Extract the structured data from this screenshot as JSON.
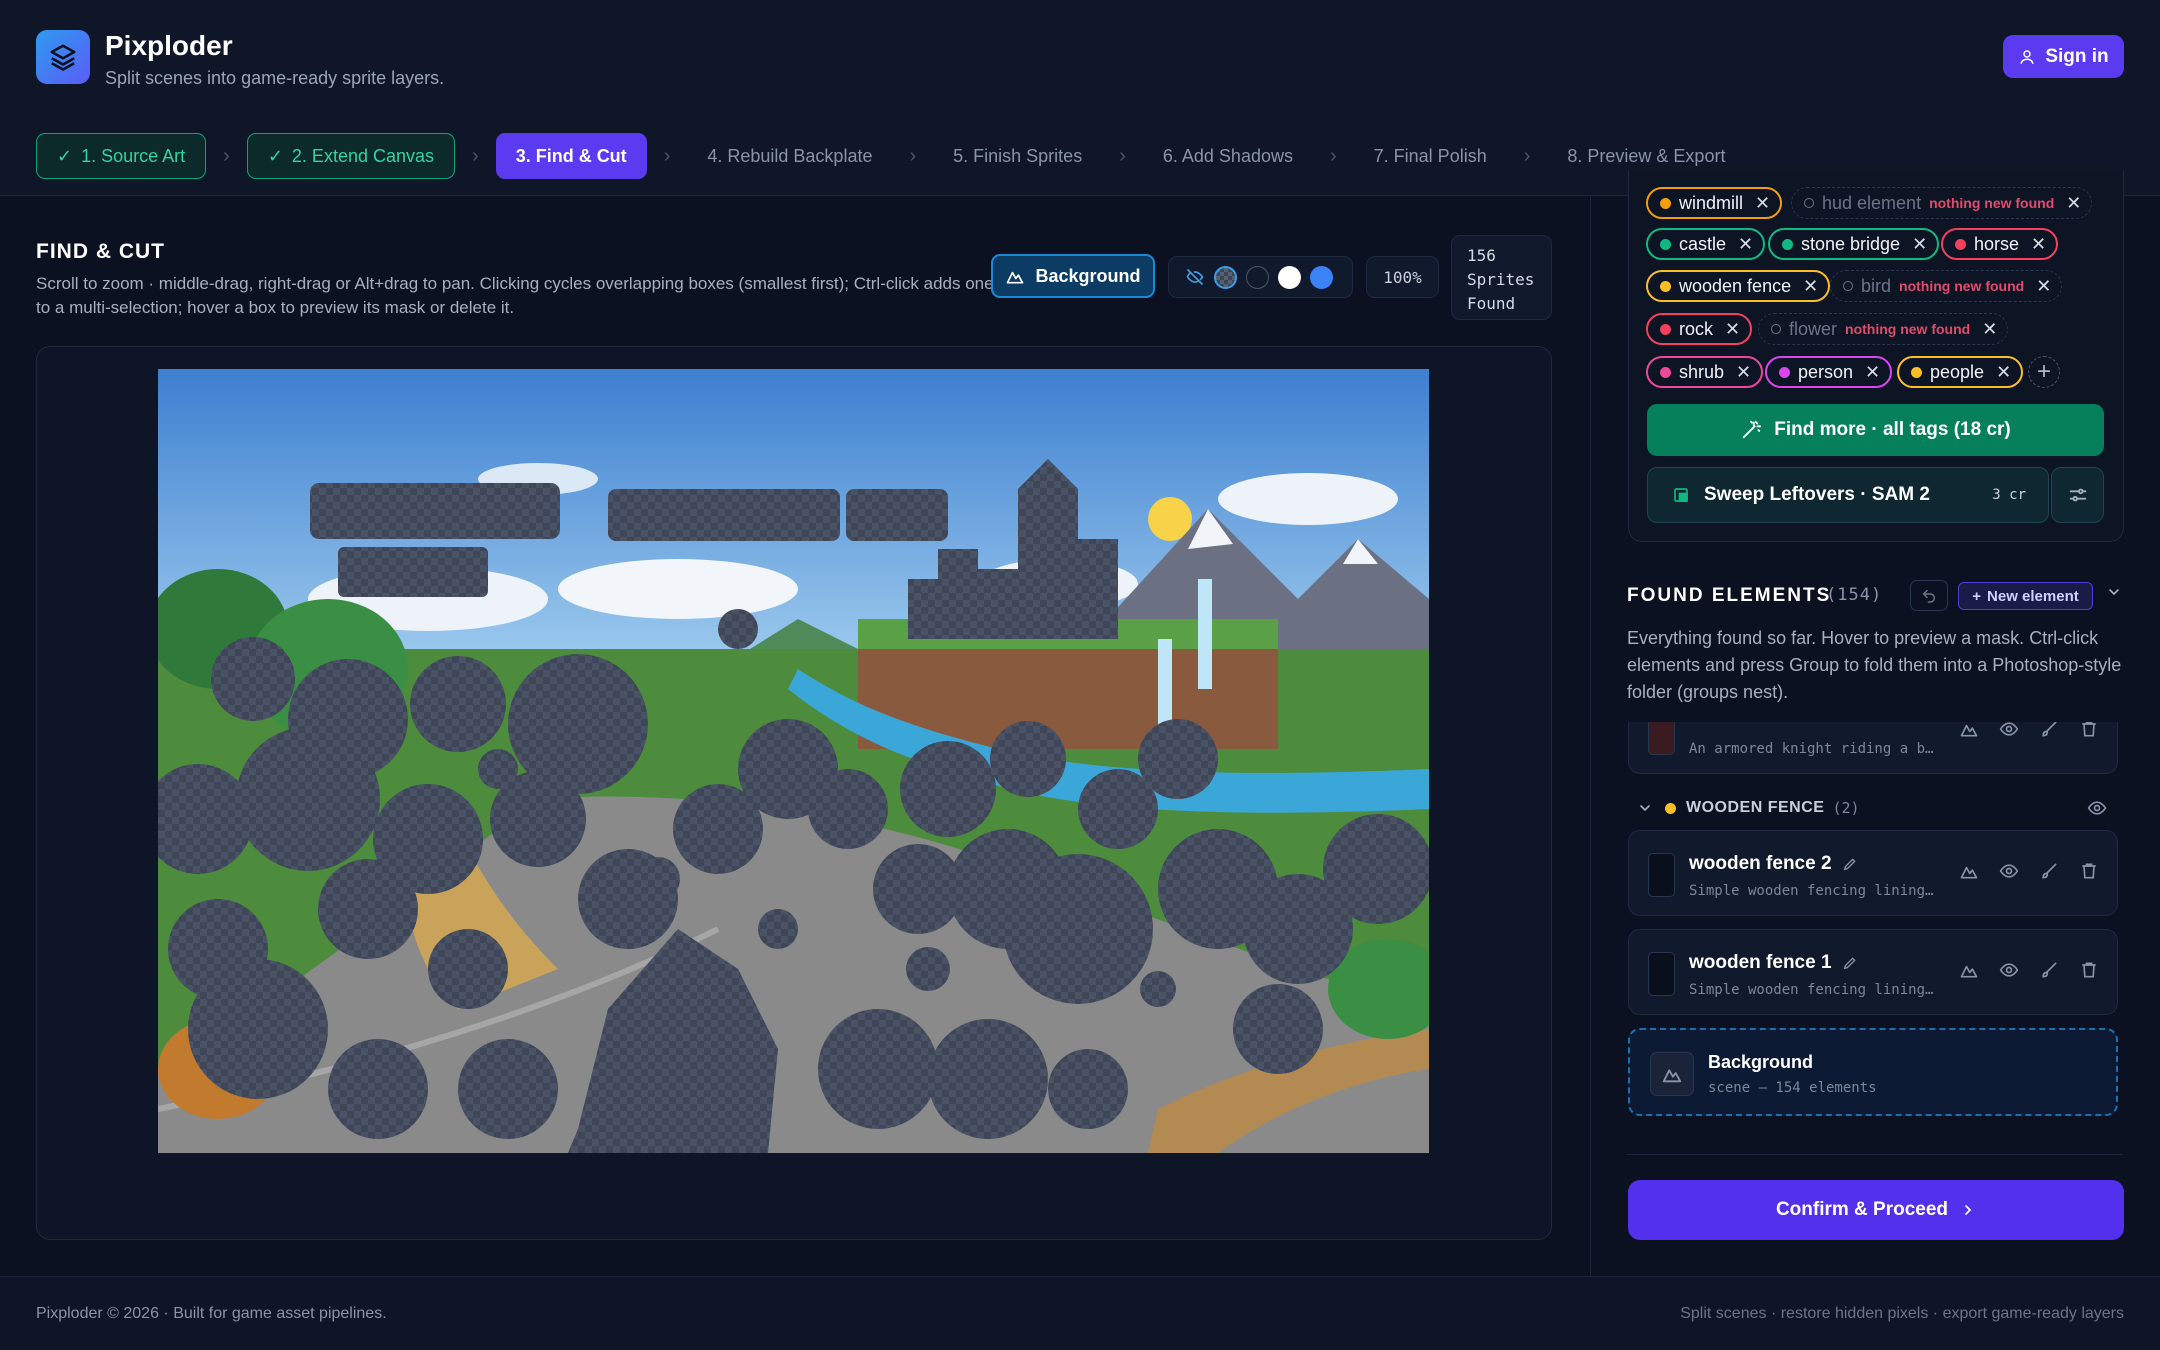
{
  "app": {
    "title": "Pixploder",
    "subtitle": "Split scenes into game-ready sprite layers.",
    "signin_label": "Sign in"
  },
  "steps": [
    {
      "label": "1. Source Art",
      "state": "done"
    },
    {
      "label": "2. Extend Canvas",
      "state": "done"
    },
    {
      "label": "3. Find & Cut",
      "state": "active"
    },
    {
      "label": "4. Rebuild Backplate",
      "state": "todo"
    },
    {
      "label": "5. Finish Sprites",
      "state": "todo"
    },
    {
      "label": "6. Add Shadows",
      "state": "todo"
    },
    {
      "label": "7. Final Polish",
      "state": "todo"
    },
    {
      "label": "8. Preview & Export",
      "state": "todo"
    }
  ],
  "findcut": {
    "title": "FIND & CUT",
    "description": "Scroll to zoom · middle-drag, right-drag or Alt+drag to pan. Clicking cycles overlapping boxes (smallest first); Ctrl-click adds one to a multi-selection; hover a box to preview its mask or delete it.",
    "background_button": "Background",
    "zoom": "100%",
    "found_count": "156",
    "found_label_1": "Sprites",
    "found_label_2": "Found",
    "swatch_colors": [
      "checker",
      "#1a2338",
      "#ffffff",
      "#3b82f6"
    ]
  },
  "tags": {
    "row0": [
      {
        "label": "windmill",
        "color": "#f59e0b",
        "border": "#f59e0b"
      },
      {
        "label": "hud element",
        "note": "nothing new found",
        "empty": true
      }
    ],
    "row1": [
      {
        "label": "castle",
        "color": "#10b981",
        "border": "#10b981"
      },
      {
        "label": "stone bridge",
        "color": "#10b981",
        "border": "#10b981"
      },
      {
        "label": "horse",
        "color": "#f43f5e",
        "border": "#f43f5e"
      }
    ],
    "row2": [
      {
        "label": "wooden fence",
        "color": "#fbbf24",
        "border": "#fbbf24"
      },
      {
        "label": "bird",
        "note": "nothing new found",
        "empty": true
      }
    ],
    "row3": [
      {
        "label": "rock",
        "color": "#f43f5e",
        "border": "#f43f5e"
      },
      {
        "label": "flower",
        "note": "nothing new found",
        "empty": true
      }
    ],
    "row4": [
      {
        "label": "shrub",
        "color": "#ec4899",
        "border": "#ec4899"
      },
      {
        "label": "person",
        "color": "#d946ef",
        "border": "#d946ef"
      },
      {
        "label": "people",
        "color": "#fbbf24",
        "border": "#fbbf24"
      }
    ],
    "find_more_label": "Find more · all tags (18 cr)",
    "sweep_label": "Sweep Leftovers · SAM 2",
    "sweep_cost": "3 cr"
  },
  "found": {
    "title": "FOUND ELEMENTS",
    "count": "(154)",
    "new_element_label": "New element",
    "description": "Everything found so far. Hover to preview a mask. Ctrl-click elements and press Group to fold them into a Photoshop-style folder (groups nest).",
    "partial_item_desc": "An armored knight riding a b…",
    "group": {
      "label": "WOODEN FENCE",
      "count": "(2)",
      "color": "#fbbf24"
    },
    "items": [
      {
        "name": "wooden fence 2",
        "desc": "Simple wooden fencing lining…"
      },
      {
        "name": "wooden fence 1",
        "desc": "Simple wooden fencing lining…"
      }
    ],
    "background_item": {
      "name": "Background",
      "sub": "scene — 154 elements"
    }
  },
  "confirm_label": "Confirm & Proceed",
  "footer": {
    "left": "Pixploder © 2026 · Built for game asset pipelines.",
    "right": "Split scenes · restore hidden pixels · export game-ready layers"
  }
}
